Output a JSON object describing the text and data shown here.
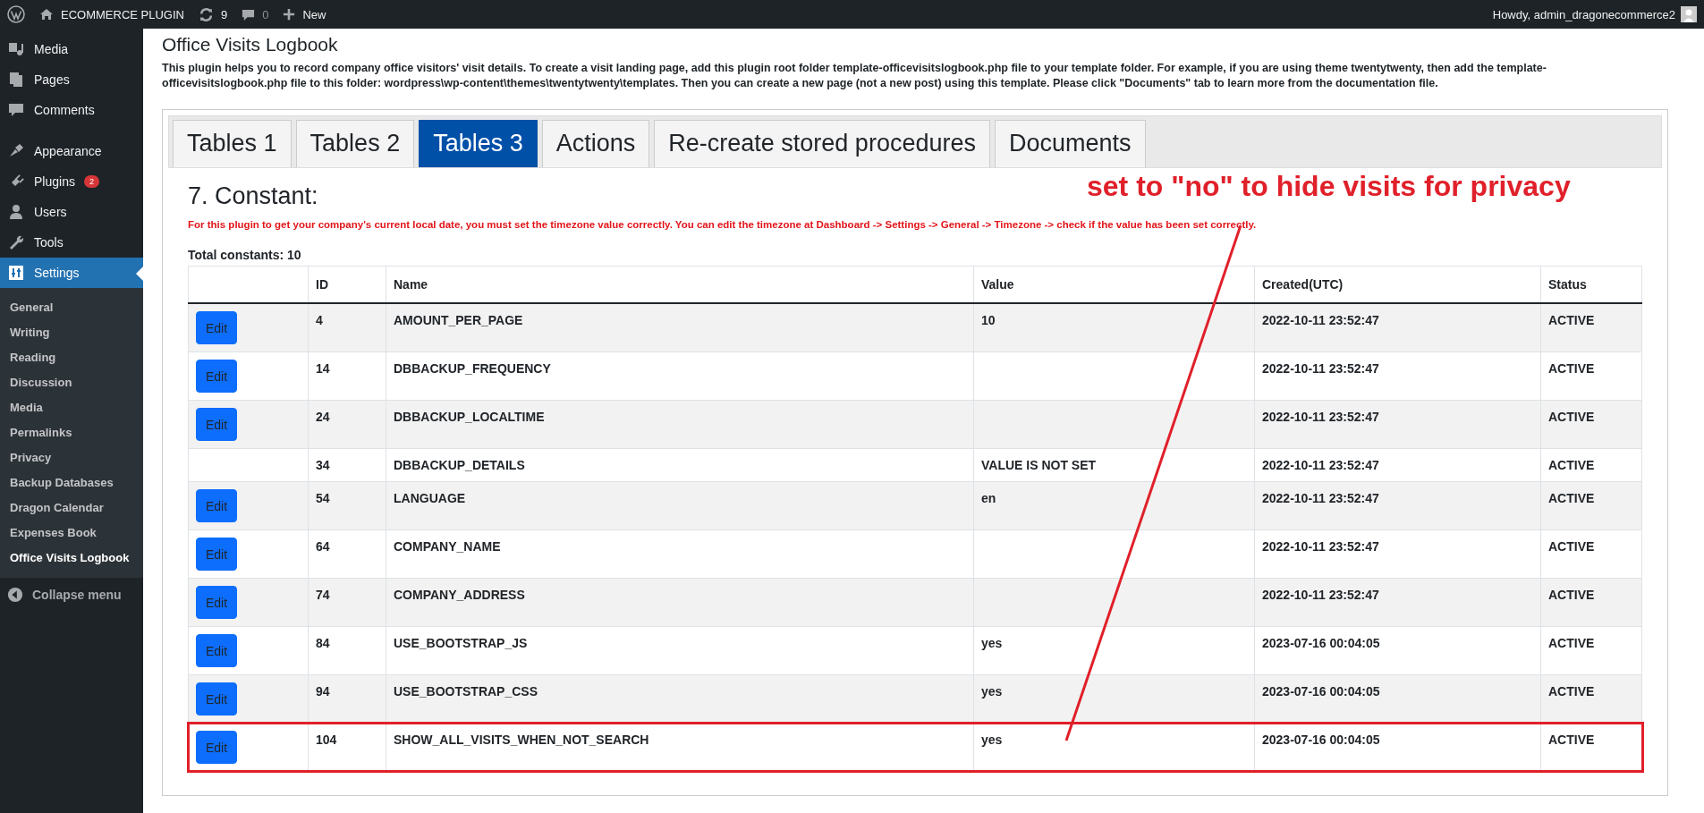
{
  "admin_bar": {
    "site": "ECOMMERCE PLUGIN",
    "updates": "9",
    "comments": "0",
    "new": "New",
    "greeting": "Howdy, admin_dragonecommerce2"
  },
  "sidebar": {
    "items": [
      {
        "label": "Media",
        "kind": "media",
        "selected": false
      },
      {
        "label": "Pages",
        "kind": "pages",
        "selected": false
      },
      {
        "label": "Comments",
        "kind": "comments",
        "selected": false
      },
      {
        "label": "Appearance",
        "kind": "appearance",
        "selected": false
      },
      {
        "label": "Plugins",
        "kind": "plugins",
        "selected": false,
        "badge": "2"
      },
      {
        "label": "Users",
        "kind": "users",
        "selected": false
      },
      {
        "label": "Tools",
        "kind": "tools",
        "selected": false
      },
      {
        "label": "Settings",
        "kind": "settings",
        "selected": true
      }
    ],
    "submenu": [
      {
        "label": "General",
        "selected": false
      },
      {
        "label": "Writing",
        "selected": false
      },
      {
        "label": "Reading",
        "selected": false
      },
      {
        "label": "Discussion",
        "selected": false
      },
      {
        "label": "Media",
        "selected": false
      },
      {
        "label": "Permalinks",
        "selected": false
      },
      {
        "label": "Privacy",
        "selected": false
      },
      {
        "label": "Backup Databases",
        "selected": false
      },
      {
        "label": "Dragon Calendar",
        "selected": false
      },
      {
        "label": "Expenses Book",
        "selected": false
      },
      {
        "label": "Office Visits Logbook",
        "selected": true
      }
    ],
    "collapse": "Collapse menu"
  },
  "page": {
    "title": "Office Visits Logbook",
    "description": "This plugin helps you to record company office visitors' visit details. To create a visit landing page, add this plugin root folder template-officevisitslogbook.php file to your template folder. For example, if you are using theme twentytwenty, then add the template-officevisitslogbook.php file to this folder: wordpress\\wp-content\\themes\\twentytwenty\\templates. Then you can create a new page (not a new post) using this template. Please click \"Documents\" tab to learn more from the documentation file."
  },
  "tabs": [
    {
      "label": "Tables 1",
      "selected": false
    },
    {
      "label": "Tables 2",
      "selected": false
    },
    {
      "label": "Tables 3",
      "selected": true
    },
    {
      "label": "Actions",
      "selected": false
    },
    {
      "label": "Re-create stored procedures",
      "selected": false
    },
    {
      "label": "Documents",
      "selected": false
    }
  ],
  "section": {
    "heading": "7. Constant:",
    "notice": "For this plugin to get your company's current local date, you must set the timezone value correctly. You can edit the timezone at Dashboard -> Settings -> General -> Timezone -> check if the value has been set correctly.",
    "total": "Total constants: 10"
  },
  "table": {
    "columns": [
      "",
      "ID",
      "Name",
      "Value",
      "Created(UTC)",
      "Status"
    ],
    "rows": [
      {
        "button": "Edit",
        "id": "4",
        "name": "AMOUNT_PER_PAGE",
        "value": "10",
        "created": "2022-10-11 23:52:47",
        "status": "ACTIVE",
        "highlighted": false
      },
      {
        "button": "Edit",
        "id": "14",
        "name": "DBBACKUP_FREQUENCY",
        "created": "2022-10-11 23:52:47",
        "status": "ACTIVE",
        "highlighted": false
      },
      {
        "button": "Edit",
        "id": "24",
        "name": "DBBACKUP_LOCALTIME",
        "created": "2022-10-11 23:52:47",
        "status": "ACTIVE",
        "highlighted": false
      },
      {
        "id": "34",
        "name": "DBBACKUP_DETAILS",
        "value": "VALUE IS NOT SET",
        "created": "2022-10-11 23:52:47",
        "status": "ACTIVE",
        "highlighted": false
      },
      {
        "button": "Edit",
        "id": "54",
        "name": "LANGUAGE",
        "value": "en",
        "created": "2022-10-11 23:52:47",
        "status": "ACTIVE",
        "highlighted": false
      },
      {
        "button": "Edit",
        "id": "64",
        "name": "COMPANY_NAME",
        "created": "2022-10-11 23:52:47",
        "status": "ACTIVE",
        "highlighted": false
      },
      {
        "button": "Edit",
        "id": "74",
        "name": "COMPANY_ADDRESS",
        "created": "2022-10-11 23:52:47",
        "status": "ACTIVE",
        "highlighted": false
      },
      {
        "button": "Edit",
        "id": "84",
        "name": "USE_BOOTSTRAP_JS",
        "value": "yes",
        "created": "2023-07-16 00:04:05",
        "status": "ACTIVE",
        "highlighted": false
      },
      {
        "button": "Edit",
        "id": "94",
        "name": "USE_BOOTSTRAP_CSS",
        "value": "yes",
        "created": "2023-07-16 00:04:05",
        "status": "ACTIVE",
        "highlighted": false
      },
      {
        "button": "Edit",
        "id": "104",
        "name": "SHOW_ALL_VISITS_WHEN_NOT_SEARCH",
        "value": "yes",
        "created": "2023-07-16 00:04:05",
        "status": "ACTIVE",
        "highlighted": true
      }
    ]
  },
  "annotation": {
    "text": "set to \"no\" to hide visits for privacy"
  }
}
